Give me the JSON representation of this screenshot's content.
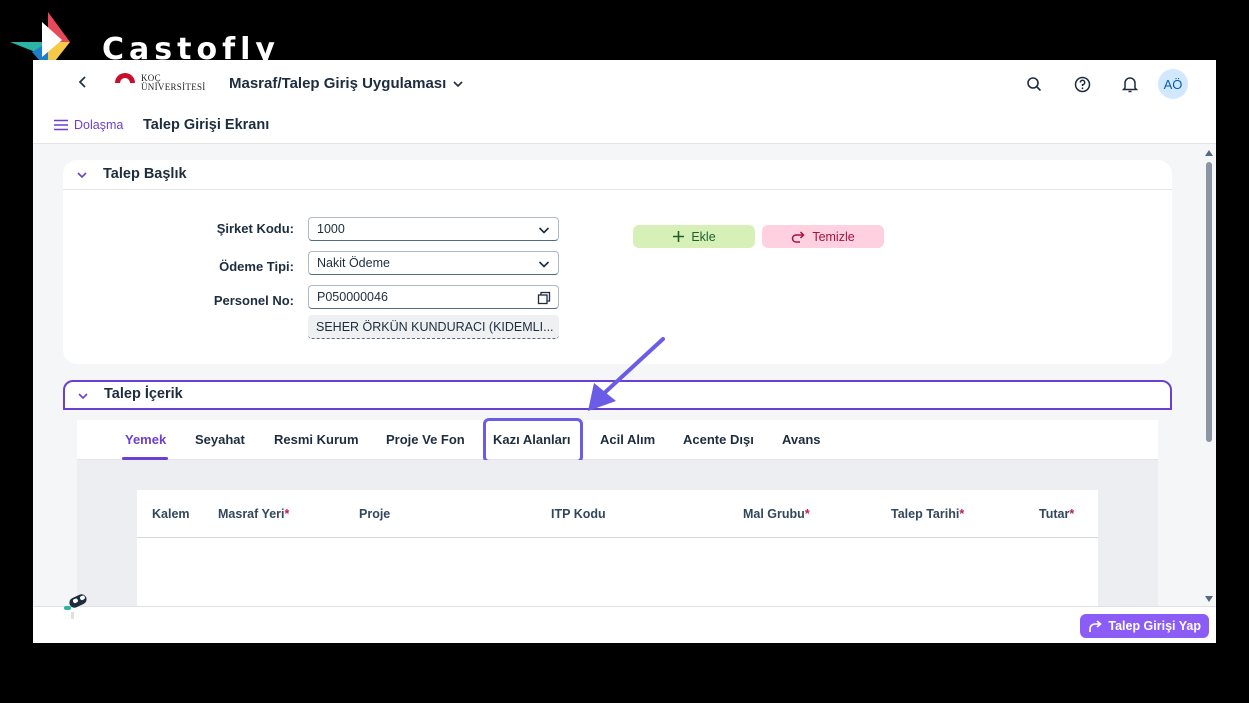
{
  "watermark": {
    "text": "Castofly"
  },
  "shellbar": {
    "logo_line1": "KOÇ",
    "logo_line2": "ÜNİVERSİTESİ",
    "app_title": "Masraf/Talep Giriş Uygulaması",
    "avatar": "AÖ",
    "icons": [
      "back-icon",
      "search-icon",
      "help-icon",
      "bell-icon"
    ]
  },
  "subheader": {
    "nav_label": "Dolaşma",
    "page_title": "Talep Girişi Ekranı"
  },
  "header_panel": {
    "title": "Talep Başlık",
    "fields": {
      "company_label": "Şirket Kodu:",
      "company_value": "1000",
      "payment_label": "Ödeme Tipi:",
      "payment_value": "Nakit Ödeme",
      "personnel_label": "Personel No:",
      "personnel_value": "P050000046",
      "personnel_name": "SEHER ÖRKÜN KUNDURACI (KIDEMLI..."
    },
    "add_label": "Ekle",
    "clear_label": "Temizle"
  },
  "content_panel": {
    "title": "Talep İçerik",
    "tabs": [
      "Yemek",
      "Seyahat",
      "Resmi Kurum",
      "Proje Ve Fon",
      "Kazı Alanları",
      "Acil Alım",
      "Acente Dışı",
      "Avans"
    ],
    "active_tab": "Yemek",
    "highlighted_tab": "Kazı Alanları",
    "columns": [
      "Kalem",
      "Masraf Yeri",
      "Proje",
      "ITP Kodu",
      "Mal Grubu",
      "Talep Tarihi",
      "Tutar"
    ],
    "required_marker": "*"
  },
  "footer": {
    "submit_label": "Talep Girişi Yap"
  },
  "colors": {
    "accent": "#6b3fd1",
    "submit": "#8b5cf6",
    "add_bg": "#d7f0b8",
    "clear_bg": "#ffd0e0"
  }
}
